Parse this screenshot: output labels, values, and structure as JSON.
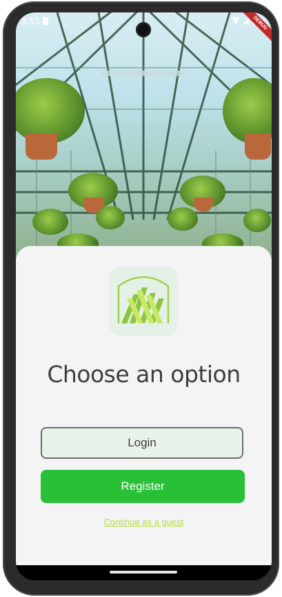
{
  "status_bar": {
    "time": "9:55",
    "debug_badge": "DEBUG"
  },
  "main": {
    "title": "Choose an option",
    "login_label": "Login",
    "register_label": "Register",
    "guest_label": "Continue as a guest"
  },
  "colors": {
    "primary_green": "#28c036",
    "login_bg": "#e8f3ea",
    "guest_link": "#b6d94e",
    "sheet_bg": "#f4f4f4"
  },
  "icons": {
    "logo": "greenhouse-logo-icon",
    "status": [
      "sim-card-icon",
      "wifi-icon",
      "signal-icon",
      "battery-icon"
    ]
  }
}
